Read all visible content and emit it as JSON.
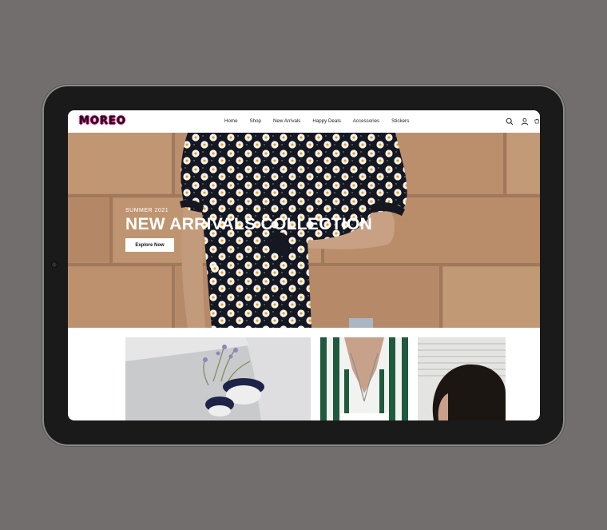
{
  "brand": {
    "logo_text": "MOREO"
  },
  "nav": {
    "links": [
      {
        "label": "Home"
      },
      {
        "label": "Shop"
      },
      {
        "label": "New Arrivals"
      },
      {
        "label": "Happy Deals"
      },
      {
        "label": "Accessories"
      },
      {
        "label": "Stickers"
      }
    ],
    "icons": [
      "search-icon",
      "user-icon",
      "cart-icon"
    ]
  },
  "hero": {
    "subtitle": "SUMMER 2021",
    "title": "NEW ARRIVALS COLLECTION",
    "button_label": "Explore Now"
  },
  "colors": {
    "backdrop": "#726e6e",
    "device_bezel": "#1a1a1a",
    "logo_accent": "#e8198c",
    "hero_brick": "#b88d6b"
  }
}
